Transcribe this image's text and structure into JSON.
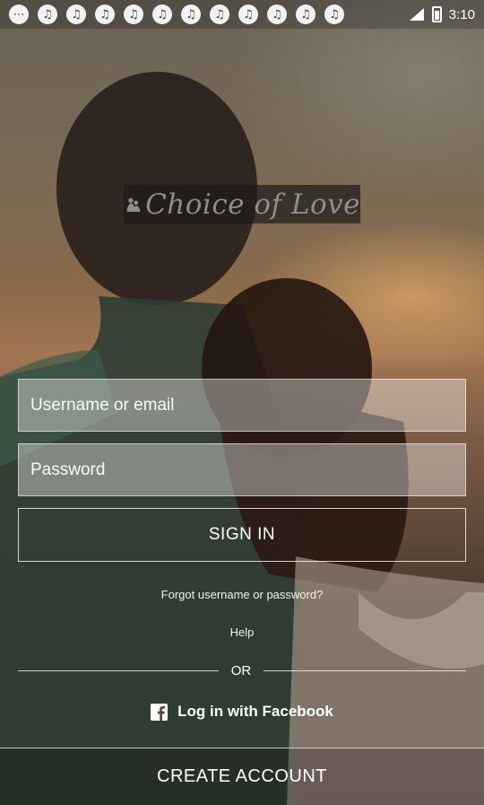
{
  "status_bar": {
    "notifications": [
      "music-note-icon",
      "music-note-icon",
      "music-note-icon",
      "music-note-icon",
      "music-note-icon",
      "music-note-icon",
      "music-note-icon",
      "music-note-icon",
      "music-note-icon",
      "music-note-icon",
      "music-note-icon",
      "music-note-icon"
    ],
    "first_icon": "chat-icon",
    "time": "3:10"
  },
  "logo": {
    "text": "Choice of Love",
    "mark": "couple-icon"
  },
  "login": {
    "username_placeholder": "Username or email",
    "password_placeholder": "Password",
    "signin_label": "SIGN IN",
    "forgot_label": "Forgot username or password?",
    "help_label": "Help",
    "or_label": "OR",
    "facebook_label": "Log in with Facebook",
    "create_account_label": "CREATE ACCOUNT"
  },
  "colors": {
    "field_bg": "#ffffff60",
    "text": "#ffffff"
  }
}
